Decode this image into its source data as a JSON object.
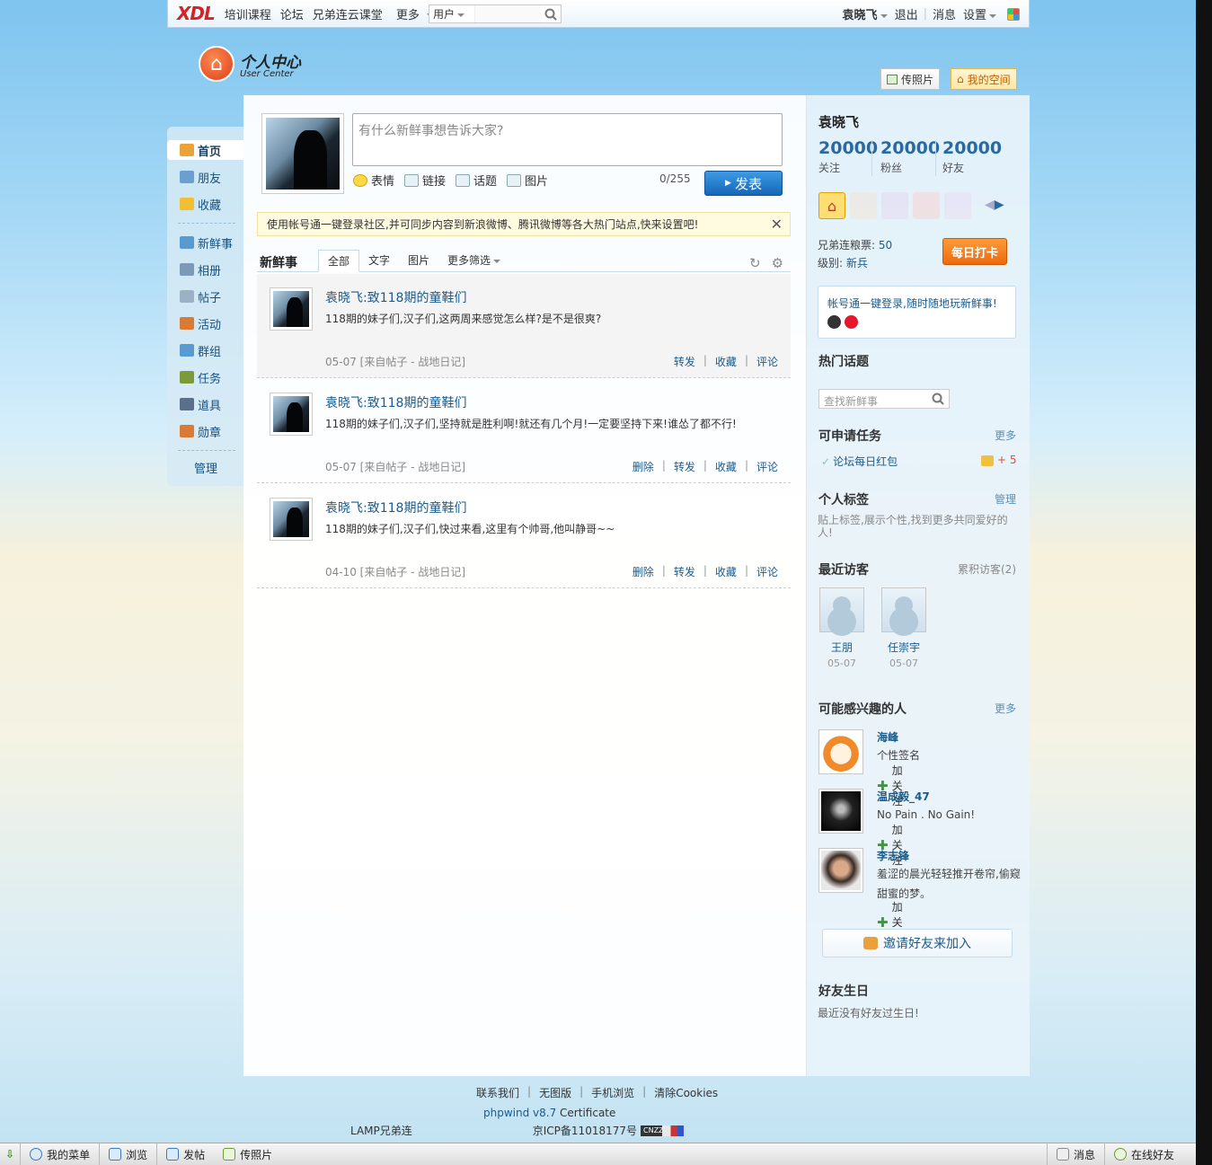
{
  "topbar": {
    "logo": "XDL",
    "nav": [
      "培训课程",
      "论坛",
      "兄弟连云课堂",
      "更多"
    ],
    "search_scope": "用户",
    "username": "袁晓飞",
    "logout": "退出",
    "messages": "消息",
    "settings": "设置"
  },
  "header": {
    "logo_cn": "个人中心",
    "logo_en": "User Center",
    "photo_button": "传照片",
    "space_button": "我的空间"
  },
  "sidebar": {
    "items": [
      {
        "label": "首页",
        "color": "#e8a33b"
      },
      {
        "label": "朋友",
        "color": "#6a9fcf"
      },
      {
        "label": "收藏",
        "color": "#f0c030"
      },
      {
        "label": "新鲜事",
        "color": "#5a9ad2"
      },
      {
        "label": "相册",
        "color": "#7c9ab6"
      },
      {
        "label": "帖子",
        "color": "#9ab1c6"
      },
      {
        "label": "活动",
        "color": "#d97b35"
      },
      {
        "label": "群组",
        "color": "#5a9ad2"
      },
      {
        "label": "任务",
        "color": "#7c9a3a"
      },
      {
        "label": "道具",
        "color": "#5a6f8a"
      },
      {
        "label": "勋章",
        "color": "#d97b35"
      }
    ],
    "manage": "管理"
  },
  "composer": {
    "placeholder": "有什么新鲜事想告诉大家?",
    "tools": [
      "表情",
      "链接",
      "话题",
      "图片"
    ],
    "counter": "0/255",
    "submit": "发表"
  },
  "notice": "使用帐号通一键登录社区,并可同步内容到新浪微博、腾讯微博等各大热门站点,快来设置吧!",
  "feed": {
    "title": "新鲜事",
    "tabs": [
      "全部",
      "文字",
      "图片",
      "更多筛选"
    ],
    "items": [
      {
        "title": "袁晓飞:致118期的童鞋们",
        "body": "118期的妹子们,汉子们,这两周来感觉怎么样?是不是很爽?",
        "meta": "05-07 [来自帖子 - 战地日记]",
        "actions": [
          "转发",
          "收藏",
          "评论"
        ]
      },
      {
        "title": "袁晓飞:致118期的童鞋们",
        "body": "118期的妹子们,汉子们,坚持就是胜利啊!就还有几个月!一定要坚持下来!谁怂了都不行!",
        "meta": "05-07 [来自帖子 - 战地日记]",
        "actions": [
          "删除",
          "转发",
          "收藏",
          "评论"
        ]
      },
      {
        "title": "袁晓飞:致118期的童鞋们",
        "body": "118期的妹子们,汉子们,快过来看,这里有个帅哥,他叫静哥~~",
        "meta": "04-10 [来自帖子 - 战地日记]",
        "actions": [
          "删除",
          "转发",
          "收藏",
          "评论"
        ]
      }
    ]
  },
  "profile": {
    "name": "袁晓飞",
    "stats": [
      {
        "value": "20000",
        "label": "关注"
      },
      {
        "value": "20000",
        "label": "粉丝"
      },
      {
        "value": "20000",
        "label": "好友"
      }
    ],
    "votes_label": "兄弟连粮票:",
    "votes_value": "50",
    "level_label": "级别:",
    "level_value": "新兵",
    "checkin": "每日打卡",
    "login_tip": "帐号通一键登录,随时随地玩新鲜事!"
  },
  "hot_topics": {
    "title": "热门话题",
    "search_placeholder": "查找新鲜事"
  },
  "tasks": {
    "title": "可申请任务",
    "more": "更多",
    "item": "论坛每日红包",
    "reward": "+ 5"
  },
  "tags": {
    "title": "个人标签",
    "manage": "管理",
    "desc": "贴上标签,展示个性,找到更多共同爱好的人!"
  },
  "visitors": {
    "title": "最近访客",
    "total": "累积访客(2)",
    "items": [
      {
        "name": "王朋",
        "date": "05-07"
      },
      {
        "name": "任崇宇",
        "date": "05-07"
      }
    ]
  },
  "suggest": {
    "title": "可能感兴趣的人",
    "more": "更多",
    "follow": "加关注",
    "people": [
      {
        "name": "海峰",
        "sig": "个性签名"
      },
      {
        "name": "温成毅_47",
        "sig": "No Pain . No Gain!"
      },
      {
        "name": "李志锋",
        "sig": "羞涩的晨光轻轻推开卷帘,偷窥甜蜜的梦。"
      }
    ],
    "invite": "邀请好友来加入"
  },
  "birthday": {
    "title": "好友生日",
    "text": "最近没有好友过生日!"
  },
  "footer": {
    "links": [
      "联系我们",
      "无图版",
      "手机浏览",
      "清除Cookies"
    ],
    "powered_brand": "phpwind v8.7",
    "powered_suffix": "Certificate",
    "company": "LAMP兄弟连",
    "icp": "京ICP备11018177号",
    "cnzz": "CNZZ"
  },
  "bottombar": {
    "items": [
      "我的菜单",
      "浏览",
      "发帖",
      "传照片"
    ],
    "right": [
      "消息",
      "在线好友"
    ]
  }
}
